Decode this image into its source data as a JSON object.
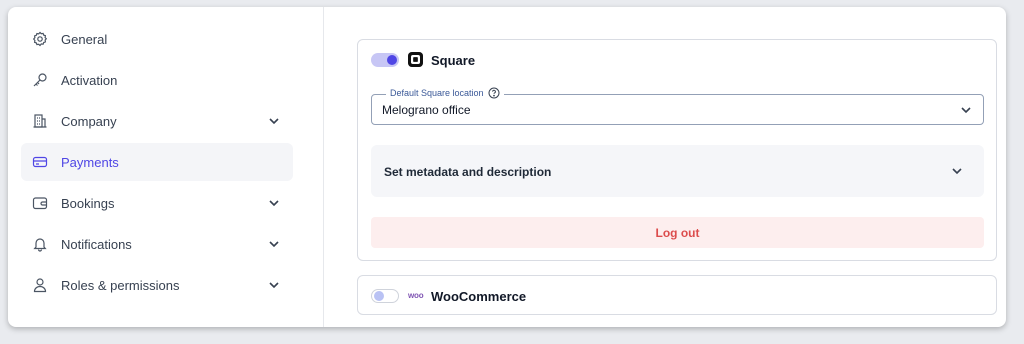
{
  "sidebar": {
    "items": [
      {
        "label": "General",
        "icon": "gear-icon"
      },
      {
        "label": "Activation",
        "icon": "key-icon"
      },
      {
        "label": "Company",
        "icon": "building-icon"
      },
      {
        "label": "Payments",
        "icon": "credit-card-icon"
      },
      {
        "label": "Bookings",
        "icon": "wallet-icon"
      },
      {
        "label": "Notifications",
        "icon": "bell-icon"
      },
      {
        "label": "Roles & permissions",
        "icon": "user-icon"
      }
    ]
  },
  "square": {
    "enabled": true,
    "name": "Square",
    "location_label": "Default Square location",
    "location_value": "Melograno office",
    "metadata_label": "Set metadata and description",
    "logout_label": "Log out"
  },
  "woocommerce": {
    "enabled": false,
    "logo_text": "woo",
    "name": "WooCommerce"
  },
  "colors": {
    "accent": "#4f46e5",
    "danger": "#dc4c4c",
    "danger_bg": "#fdeeee",
    "woo_purple": "#7f54b3"
  }
}
